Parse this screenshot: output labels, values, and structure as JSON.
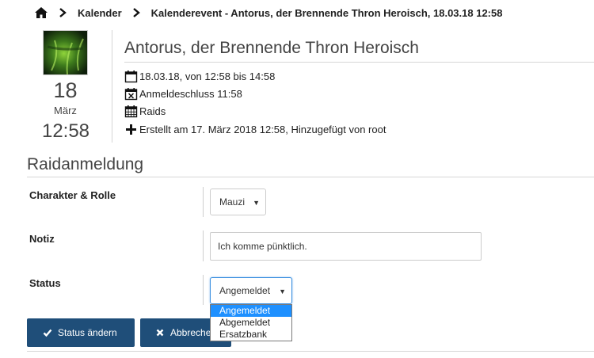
{
  "breadcrumb": {
    "items": [
      "Kalender",
      "Kalenderevent - Antorus, der Brennende Thron Heroisch, 18.03.18 12:58"
    ]
  },
  "event": {
    "day": "18",
    "month": "März",
    "time": "12:58",
    "title": "Antorus, der Brennende Thron Heroisch",
    "date_range": "18.03.18, von 12:58 bis 14:58",
    "signup_deadline": "Anmeldeschluss 11:58",
    "category": "Raids",
    "created": "Erstellt am 17. März 2018 12:58, Hinzugefügt von root"
  },
  "signup": {
    "section_title": "Raidanmeldung",
    "character_label": "Charakter & Rolle",
    "character_value": "Mauzi",
    "note_label": "Notiz",
    "note_value": "Ich komme pünktlich.",
    "status_label": "Status",
    "status_value": "Angemeldet",
    "status_options": [
      "Angemeldet",
      "Abgemeldet",
      "Ersatzbank"
    ]
  },
  "buttons": {
    "save_label": "Status ändern",
    "cancel_label": "Abbrechen"
  },
  "colors": {
    "button_bg": "#1f4e79",
    "option_highlight": "#1e90ff",
    "focus_border": "#3b8fe0"
  },
  "icons": [
    "home-icon",
    "chevron-right-icon",
    "calendar-icon",
    "calendar-x-icon",
    "calendar-grid-icon",
    "plus-icon",
    "check-icon",
    "x-icon"
  ]
}
